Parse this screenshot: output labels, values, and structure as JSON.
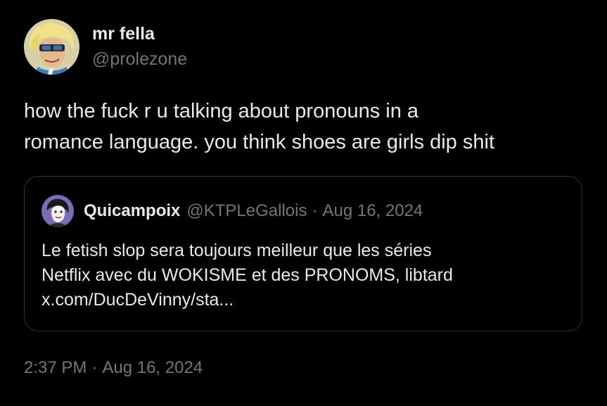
{
  "author": {
    "display_name": "mr fella",
    "handle": "@prolezone",
    "avatar_icon": "cartoon-character-avatar-icon"
  },
  "tweet": {
    "text_lines": [
      "how the fuck r u talking about pronouns in a",
      "romance language. you think shoes are girls dip shit"
    ],
    "time": "2:37 PM",
    "separator": "·",
    "date": "Aug 16, 2024"
  },
  "quoted_tweet": {
    "display_name": "Quicampoix",
    "handle": "@KTPLeGallois",
    "separator": "·",
    "date": "Aug 16, 2024",
    "avatar_icon": "profile-photo-avatar-icon",
    "text_lines": [
      "Le fetish slop sera toujours meilleur que les séries",
      "Netflix avec du WOKISME et des PRONOMS, libtard",
      "x.com/DucDeVinny/sta..."
    ]
  },
  "colors": {
    "background": "#000000",
    "text_primary": "#e7e9ea",
    "text_secondary": "#71767b",
    "border": "#2f3336"
  }
}
